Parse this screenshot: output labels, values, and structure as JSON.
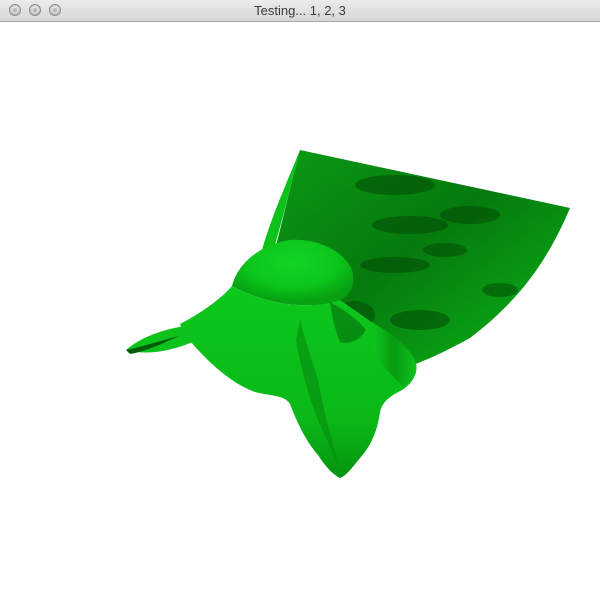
{
  "window": {
    "title": "Testing... 1, 2, 3"
  },
  "scene": {
    "object": "draped-cloth-surface",
    "color": "#0cc91c",
    "shadow_color": "#005a00",
    "background": "#ffffff"
  }
}
